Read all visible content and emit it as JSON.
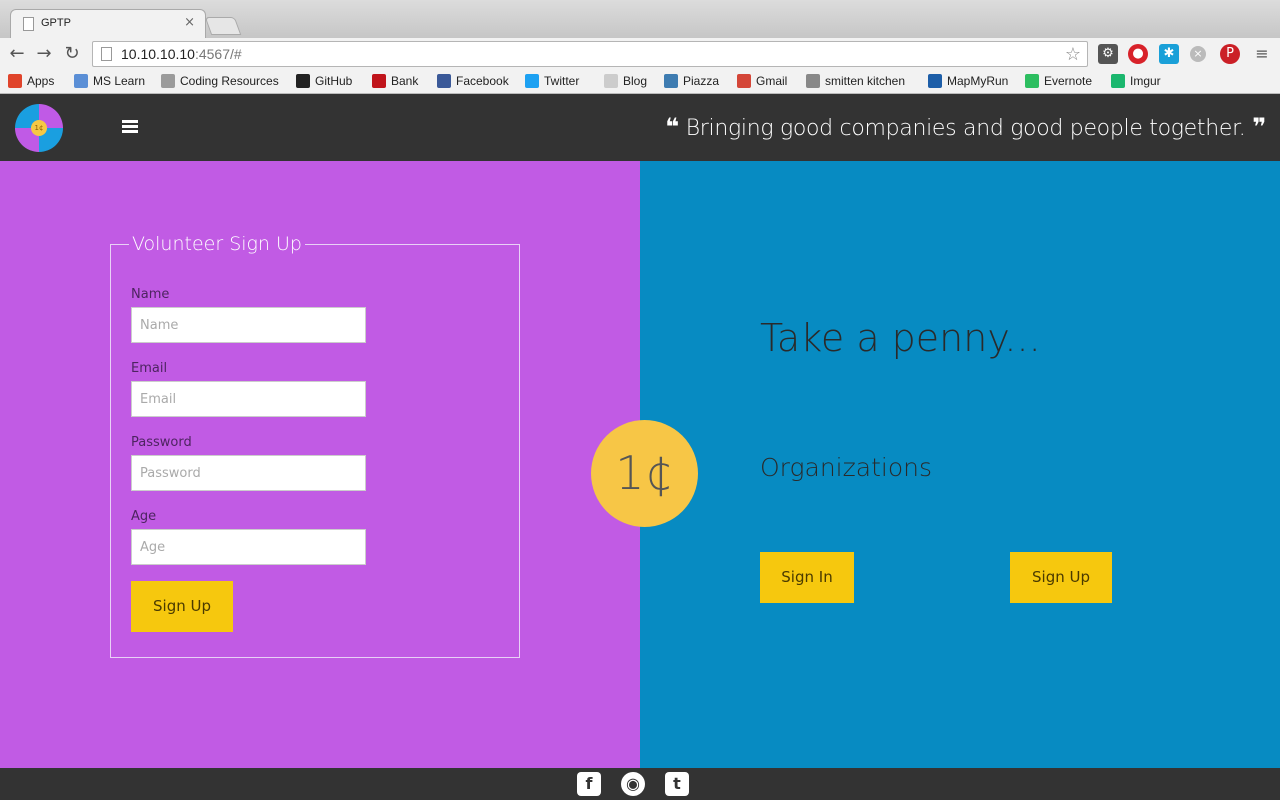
{
  "browser": {
    "tab_title": "GPTP",
    "tab_close": "×",
    "url_host": "10.10.10.10",
    "url_rest": ":4567/#",
    "bookmarks": [
      {
        "label": "Apps",
        "color": "#e0442b"
      },
      {
        "label": "MS Learn",
        "color": "#5b8fd6"
      },
      {
        "label": "Coding Resources",
        "color": "#9b9b9b"
      },
      {
        "label": "GitHub",
        "color": "#222222"
      },
      {
        "label": "Bank",
        "color": "#c0141b"
      },
      {
        "label": "Facebook",
        "color": "#3b5998"
      },
      {
        "label": "Twitter",
        "color": "#1da1f2"
      },
      {
        "label": "Blog",
        "color": "#cccccc"
      },
      {
        "label": "Piazza",
        "color": "#3e7cb1"
      },
      {
        "label": "Gmail",
        "color": "#d44638"
      },
      {
        "label": "smitten kitchen",
        "color": "#888888"
      },
      {
        "label": "MapMyRun",
        "color": "#1d5ea8"
      },
      {
        "label": "Evernote",
        "color": "#2dbe60"
      },
      {
        "label": "Imgur",
        "color": "#1bb76e"
      }
    ]
  },
  "header": {
    "logo_coin": "1¢",
    "tagline": "Bringing good companies and good people together."
  },
  "volunteer": {
    "legend": "Volunteer Sign Up",
    "fields": [
      {
        "label": "Name",
        "placeholder": "Name"
      },
      {
        "label": "Email",
        "placeholder": "Email"
      },
      {
        "label": "Password",
        "placeholder": "Password"
      },
      {
        "label": "Age",
        "placeholder": "Age"
      }
    ],
    "submit": "Sign Up"
  },
  "penny": "1¢",
  "organizations": {
    "heading": "Take a penny...",
    "subheading": "Organizations",
    "sign_in": "Sign In",
    "sign_up": "Sign Up"
  },
  "colors": {
    "volunteer_bg": "#c15be4",
    "org_bg": "#078bc2",
    "accent_yellow": "#f6c80e",
    "penny": "#f7c646",
    "header_bg": "#333333"
  },
  "footer": {
    "icons": [
      "facebook-icon",
      "github-icon",
      "twitter-icon"
    ]
  }
}
